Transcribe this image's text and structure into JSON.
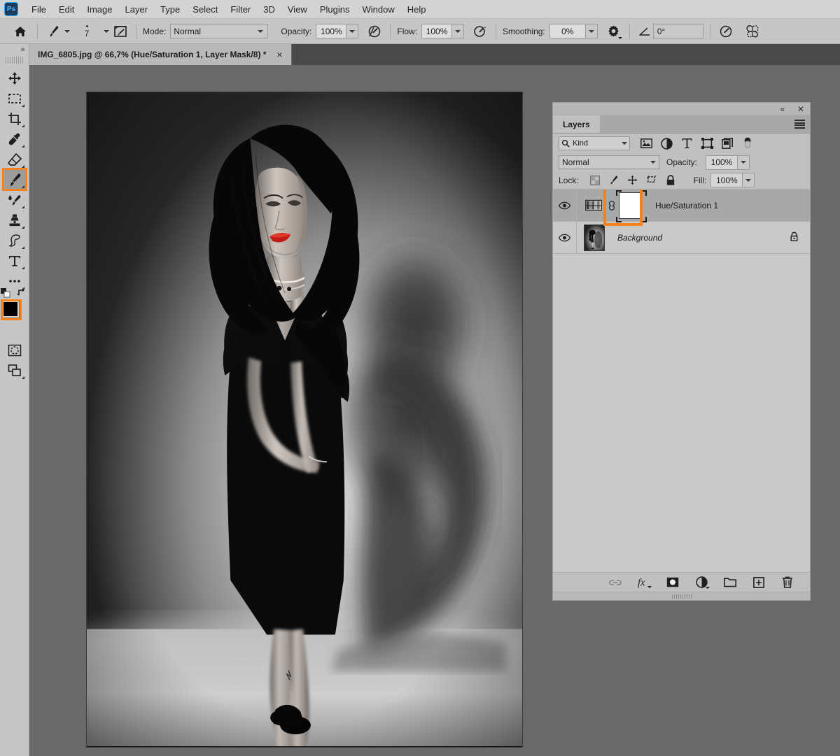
{
  "app": {
    "logo_text": "Ps",
    "accent_color": "#f58220",
    "brand_color": "#31a8ff"
  },
  "menubar": {
    "items": [
      "File",
      "Edit",
      "Image",
      "Layer",
      "Type",
      "Select",
      "Filter",
      "3D",
      "View",
      "Plugins",
      "Window",
      "Help"
    ]
  },
  "options_bar": {
    "home_icon": "home-icon",
    "brush_preset_icon": "brush-icon",
    "brush_size": "7",
    "brush_settings_icon": "brush-settings-panel-icon",
    "mode_label": "Mode:",
    "mode_value": "Normal",
    "opacity_label": "Opacity:",
    "opacity_value": "100%",
    "pressure_opacity_icon": "pressure-opacity-icon",
    "flow_label": "Flow:",
    "flow_value": "100%",
    "airbrush_icon": "airbrush-icon",
    "smoothing_label": "Smoothing:",
    "smoothing_value": "0%",
    "smoothing_options_icon": "gear-icon",
    "angle_icon": "angle-icon",
    "angle_value": "0°",
    "pressure_size_icon": "pressure-size-icon",
    "symmetry_icon": "symmetry-butterfly-icon"
  },
  "document_tab": {
    "title": "IMG_6805.jpg @ 66,7% (Hue/Saturation 1, Layer Mask/8) *",
    "close_label": "×"
  },
  "toolbar": {
    "expand_label": "»",
    "tools": [
      {
        "name": "move-tool",
        "title": "Move Tool",
        "has_submenu": false,
        "active": false
      },
      {
        "name": "rectangular-marquee-tool",
        "title": "Rectangular Marquee Tool",
        "has_submenu": true,
        "active": false
      },
      {
        "name": "crop-tool",
        "title": "Crop Tool",
        "has_submenu": true,
        "active": false
      },
      {
        "name": "eyedropper-tool",
        "title": "Eyedropper Tool",
        "has_submenu": true,
        "active": false
      },
      {
        "name": "eraser-tool",
        "title": "Eraser Tool",
        "has_submenu": true,
        "active": false
      },
      {
        "name": "brush-tool",
        "title": "Brush Tool",
        "has_submenu": true,
        "active": true
      },
      {
        "name": "healing-brush-tool",
        "title": "Spot Healing Brush Tool",
        "has_submenu": true,
        "active": false
      },
      {
        "name": "clone-stamp-tool",
        "title": "Clone Stamp Tool",
        "has_submenu": true,
        "active": false
      },
      {
        "name": "smudge-tool",
        "title": "Smudge Tool",
        "has_submenu": true,
        "active": false
      },
      {
        "name": "type-tool",
        "title": "Horizontal Type Tool",
        "has_submenu": true,
        "active": false
      },
      {
        "name": "more-tools",
        "title": "Edit Toolbar",
        "has_submenu": true,
        "active": false
      }
    ],
    "foreground_color": "#000000",
    "background_color": "#ffffff",
    "default_colors_icon": "default-colors-icon",
    "swap_colors_icon": "swap-colors-icon",
    "quick_mask_icon": "quick-mask-icon",
    "screen_mode_icon": "screen-mode-icon"
  },
  "canvas": {
    "zoom": "66,7%",
    "background_color": "#696969"
  },
  "layers_panel": {
    "collapse_icon": "«",
    "close_icon": "✕",
    "tab_label": "Layers",
    "menu_icon": "panel-menu-icon",
    "filter": {
      "search_icon": "search-icon",
      "kind_label": "Kind",
      "icons": [
        "pixel-layer-filter-icon",
        "adjustment-layer-filter-icon",
        "type-layer-filter-icon",
        "shape-layer-filter-icon",
        "smart-object-filter-icon",
        "filter-toggle-icon"
      ]
    },
    "blend_mode": "Normal",
    "opacity_label": "Opacity:",
    "opacity_value": "100%",
    "lock_label": "Lock:",
    "lock_icons": [
      "lock-transparent-pixels-icon",
      "lock-image-pixels-icon",
      "lock-position-icon",
      "lock-artboard-icon",
      "lock-all-icon"
    ],
    "fill_label": "Fill:",
    "fill_value": "100%",
    "layers": [
      {
        "name": "Hue/Saturation 1",
        "visible": true,
        "selected": true,
        "type": "adjustment",
        "has_mask": true,
        "mask_selected": true,
        "locked": false,
        "italic": false
      },
      {
        "name": "Background",
        "visible": true,
        "selected": false,
        "type": "image",
        "has_mask": false,
        "mask_selected": false,
        "locked": true,
        "italic": true
      }
    ],
    "footer_buttons": [
      {
        "name": "link-layers-button",
        "icon": "link-icon",
        "enabled": false
      },
      {
        "name": "layer-style-button",
        "icon": "fx-icon",
        "enabled": true
      },
      {
        "name": "add-layer-mask-button",
        "icon": "mask-icon",
        "enabled": true
      },
      {
        "name": "new-adjustment-layer-button",
        "icon": "half-circle-icon",
        "enabled": true
      },
      {
        "name": "new-group-button",
        "icon": "folder-icon",
        "enabled": true
      },
      {
        "name": "new-layer-button",
        "icon": "plus-square-icon",
        "enabled": true
      },
      {
        "name": "delete-layer-button",
        "icon": "trash-icon",
        "enabled": true
      }
    ]
  }
}
